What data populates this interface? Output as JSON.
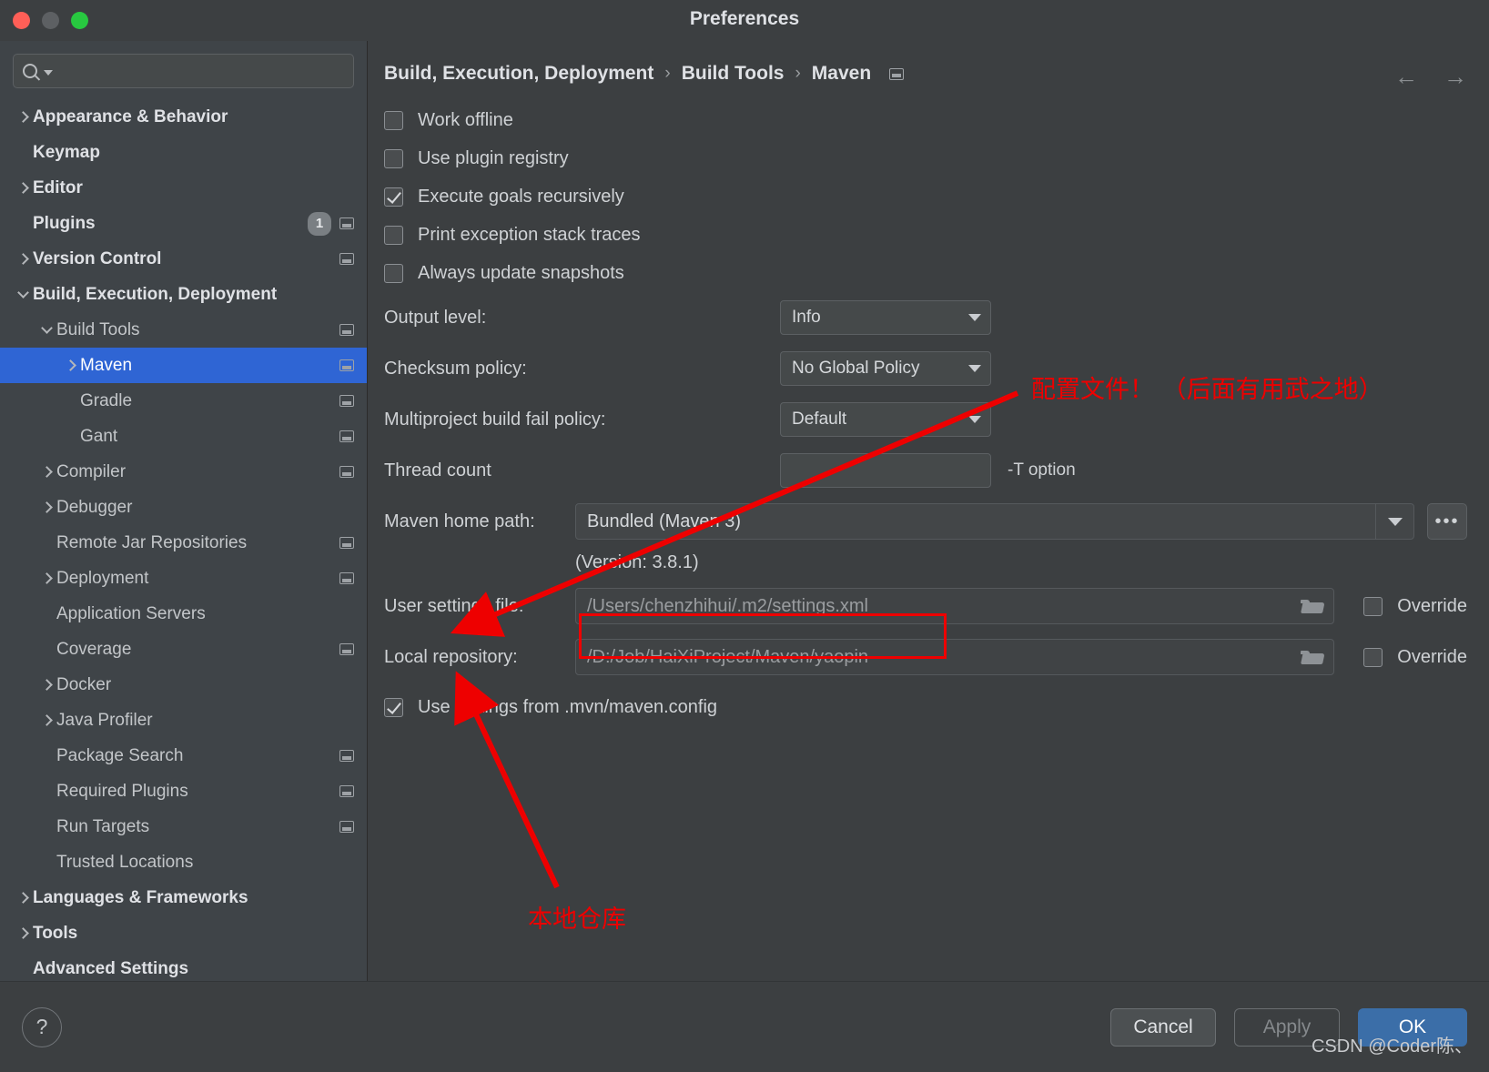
{
  "window": {
    "title": "Preferences",
    "traffic_lights": [
      "close-button",
      "minimize-button",
      "zoom-button"
    ]
  },
  "sidebar": {
    "search": {
      "value": "",
      "placeholder": ""
    },
    "items": [
      {
        "label": "Appearance & Behavior",
        "indent": 0,
        "arrow": "right",
        "bold": true,
        "selected": false,
        "badge": null,
        "project_icon": false
      },
      {
        "label": "Keymap",
        "indent": 0,
        "arrow": "none",
        "bold": true,
        "selected": false,
        "badge": null,
        "project_icon": false
      },
      {
        "label": "Editor",
        "indent": 0,
        "arrow": "right",
        "bold": true,
        "selected": false,
        "badge": null,
        "project_icon": false
      },
      {
        "label": "Plugins",
        "indent": 0,
        "arrow": "none",
        "bold": true,
        "selected": false,
        "badge": "1",
        "project_icon": true
      },
      {
        "label": "Version Control",
        "indent": 0,
        "arrow": "right",
        "bold": true,
        "selected": false,
        "badge": null,
        "project_icon": true
      },
      {
        "label": "Build, Execution, Deployment",
        "indent": 0,
        "arrow": "down",
        "bold": true,
        "selected": false,
        "badge": null,
        "project_icon": false
      },
      {
        "label": "Build Tools",
        "indent": 1,
        "arrow": "down",
        "bold": false,
        "selected": false,
        "badge": null,
        "project_icon": true
      },
      {
        "label": "Maven",
        "indent": 2,
        "arrow": "right",
        "bold": false,
        "selected": true,
        "badge": null,
        "project_icon": true
      },
      {
        "label": "Gradle",
        "indent": 2,
        "arrow": "none",
        "bold": false,
        "selected": false,
        "badge": null,
        "project_icon": true
      },
      {
        "label": "Gant",
        "indent": 2,
        "arrow": "none",
        "bold": false,
        "selected": false,
        "badge": null,
        "project_icon": true
      },
      {
        "label": "Compiler",
        "indent": 1,
        "arrow": "right",
        "bold": false,
        "selected": false,
        "badge": null,
        "project_icon": true
      },
      {
        "label": "Debugger",
        "indent": 1,
        "arrow": "right",
        "bold": false,
        "selected": false,
        "badge": null,
        "project_icon": false
      },
      {
        "label": "Remote Jar Repositories",
        "indent": 1,
        "arrow": "none",
        "bold": false,
        "selected": false,
        "badge": null,
        "project_icon": true
      },
      {
        "label": "Deployment",
        "indent": 1,
        "arrow": "right",
        "bold": false,
        "selected": false,
        "badge": null,
        "project_icon": true
      },
      {
        "label": "Application Servers",
        "indent": 1,
        "arrow": "none",
        "bold": false,
        "selected": false,
        "badge": null,
        "project_icon": false
      },
      {
        "label": "Coverage",
        "indent": 1,
        "arrow": "none",
        "bold": false,
        "selected": false,
        "badge": null,
        "project_icon": true
      },
      {
        "label": "Docker",
        "indent": 1,
        "arrow": "right",
        "bold": false,
        "selected": false,
        "badge": null,
        "project_icon": false
      },
      {
        "label": "Java Profiler",
        "indent": 1,
        "arrow": "right",
        "bold": false,
        "selected": false,
        "badge": null,
        "project_icon": false
      },
      {
        "label": "Package Search",
        "indent": 1,
        "arrow": "none",
        "bold": false,
        "selected": false,
        "badge": null,
        "project_icon": true
      },
      {
        "label": "Required Plugins",
        "indent": 1,
        "arrow": "none",
        "bold": false,
        "selected": false,
        "badge": null,
        "project_icon": true
      },
      {
        "label": "Run Targets",
        "indent": 1,
        "arrow": "none",
        "bold": false,
        "selected": false,
        "badge": null,
        "project_icon": true
      },
      {
        "label": "Trusted Locations",
        "indent": 1,
        "arrow": "none",
        "bold": false,
        "selected": false,
        "badge": null,
        "project_icon": false
      },
      {
        "label": "Languages & Frameworks",
        "indent": 0,
        "arrow": "right",
        "bold": true,
        "selected": false,
        "badge": null,
        "project_icon": false
      },
      {
        "label": "Tools",
        "indent": 0,
        "arrow": "right",
        "bold": true,
        "selected": false,
        "badge": null,
        "project_icon": false
      },
      {
        "label": "Advanced Settings",
        "indent": 0,
        "arrow": "none",
        "bold": true,
        "selected": false,
        "badge": null,
        "project_icon": false
      }
    ]
  },
  "main": {
    "breadcrumb": {
      "part1": "Build, Execution, Deployment",
      "part2": "Build Tools",
      "part3": "Maven",
      "separator": "›"
    },
    "nav": {
      "back": "←",
      "forward": "→"
    },
    "checkboxes": [
      {
        "label": "Work offline",
        "checked": false
      },
      {
        "label": "Use plugin registry",
        "checked": false
      },
      {
        "label": "Execute goals recursively",
        "checked": true
      },
      {
        "label": "Print exception stack traces",
        "checked": false
      },
      {
        "label": "Always update snapshots",
        "checked": false
      }
    ],
    "output_level": {
      "label": "Output level:",
      "value": "Info"
    },
    "checksum_policy": {
      "label": "Checksum policy:",
      "value": "No Global Policy"
    },
    "multiproject_policy": {
      "label": "Multiproject build fail policy:",
      "value": "Default"
    },
    "thread_count": {
      "label": "Thread count",
      "value": "",
      "hint": "-T option"
    },
    "maven_home": {
      "label": "Maven home path:",
      "value": "Bundled (Maven 3)",
      "ellipsis": "•••"
    },
    "version_note": "(Version: 3.8.1)",
    "user_settings": {
      "label": "User settings file:",
      "value": "/Users/chenzhihui/.m2/settings.xml",
      "override_label": "Override",
      "override_checked": false
    },
    "local_repository": {
      "label": "Local repository:",
      "value": "/D:/Job/HaiXiProject/Maven/yaopin",
      "override_label": "Override",
      "override_checked": false
    },
    "mvn_config": {
      "label": "Use settings from .mvn/maven.config",
      "checked": true
    }
  },
  "footer": {
    "help_label": "?",
    "cancel_label": "Cancel",
    "apply_label": "Apply",
    "ok_label": "OK"
  },
  "annotations": {
    "config_note": "配置文件！ （后面有用武之地）",
    "local_repo_note": "本地仓库",
    "color": "#ee0000"
  },
  "watermark": "CSDN @Coder陈、"
}
